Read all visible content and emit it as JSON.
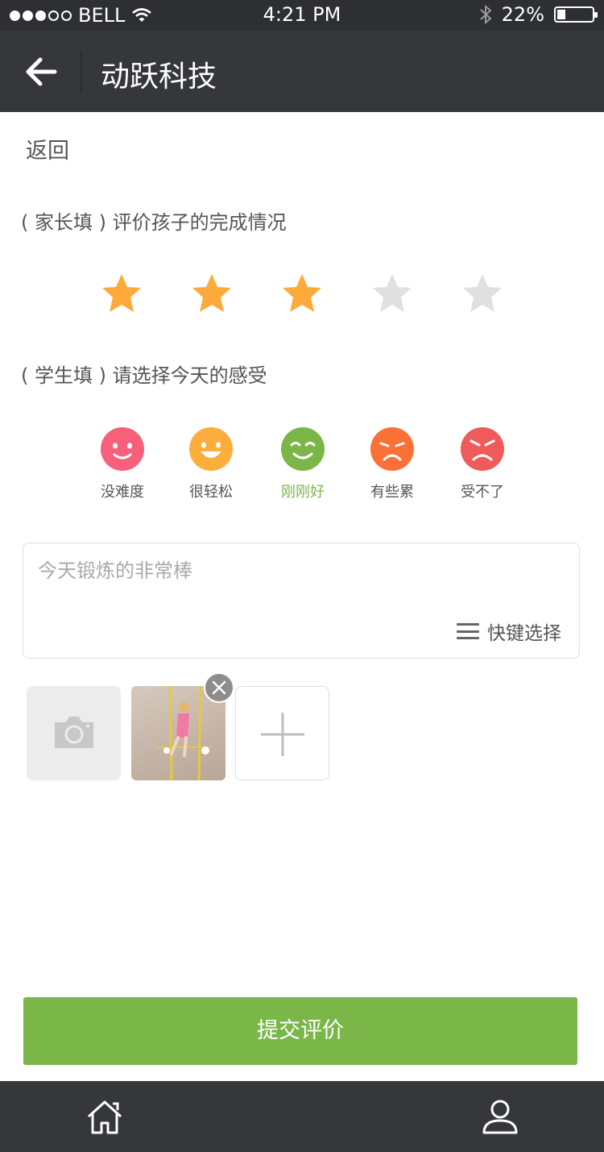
{
  "status_bar": {
    "carrier": "BELL",
    "time": "4:21 PM",
    "battery": "22%"
  },
  "nav": {
    "title": "动跃科技"
  },
  "back_link": "返回",
  "parent_section": {
    "label": "( 家长填 ) 评价孩子的完成情况",
    "rating": 3,
    "max_rating": 5
  },
  "student_section": {
    "label": "( 学生填 ) 请选择今天的感受",
    "selected": "刚刚好",
    "moods": [
      {
        "label": "没难度",
        "color": "#f7607a"
      },
      {
        "label": "很轻松",
        "color": "#fcae3c"
      },
      {
        "label": "刚刚好",
        "color": "#7ab648"
      },
      {
        "label": "有些累",
        "color": "#fa7138"
      },
      {
        "label": "受不了",
        "color": "#ef5a5a"
      }
    ]
  },
  "comment": {
    "placeholder": "今天锻炼的非常棒",
    "quick_select": "快键选择"
  },
  "submit": "提交评价",
  "colors": {
    "accent": "#7ab648",
    "star_on": "#fdaa3b",
    "star_off": "#e0e0e0",
    "nav_bg": "#36373b"
  }
}
